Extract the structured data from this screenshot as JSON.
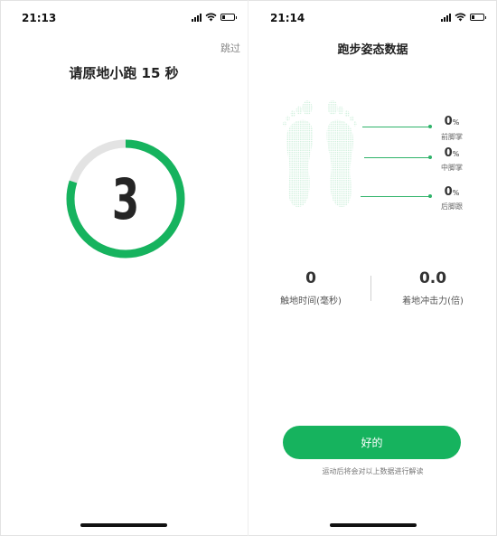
{
  "left_screen": {
    "status_time": "21:13",
    "skip_label": "跳过",
    "countdown_title": "请原地小跑 15 秒",
    "countdown_number": "3",
    "countdown_progress": 0.8
  },
  "right_screen": {
    "status_time": "21:14",
    "page_title": "跑步姿态数据",
    "foot_metrics": [
      {
        "value": "0",
        "unit": "%",
        "label": "前脚掌"
      },
      {
        "value": "0",
        "unit": "%",
        "label": "中脚掌"
      },
      {
        "value": "0",
        "unit": "%",
        "label": "后脚跟"
      }
    ],
    "stats": {
      "contact_time": {
        "value": "0",
        "label": "触地时间(毫秒)"
      },
      "impact_force": {
        "value": "0.0",
        "label": "着地冲击力(倍)"
      }
    },
    "ok_button_label": "好的",
    "note": "运动后将会对以上数据进行解读"
  },
  "colors": {
    "accent": "#16b35e",
    "ring_track": "#e3e3e3",
    "footprint": "#c9eed8"
  },
  "icons": [
    "signal-icon",
    "wifi-icon",
    "battery-icon"
  ]
}
